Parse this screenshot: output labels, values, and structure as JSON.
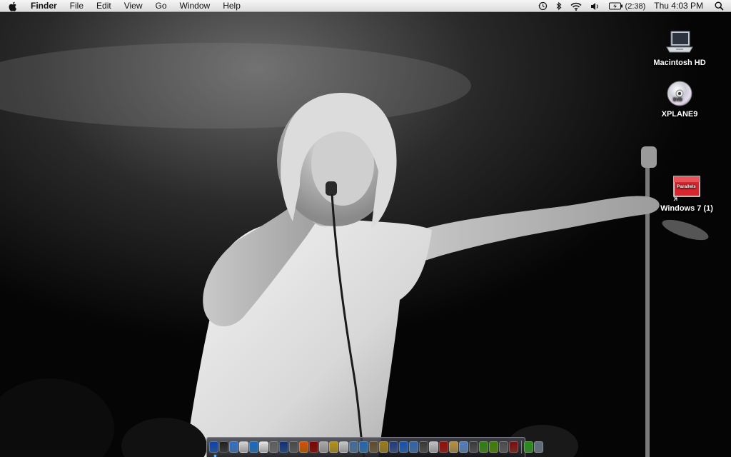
{
  "menubar": {
    "apple_icon": "apple-logo-icon",
    "app_name": "Finder",
    "menus": [
      "File",
      "Edit",
      "View",
      "Go",
      "Window",
      "Help"
    ],
    "status_icons": [
      "time-machine-icon",
      "bluetooth-icon",
      "wifi-icon",
      "volume-icon",
      "battery-icon",
      "spotlight-icon"
    ],
    "battery_time": "(2:38)",
    "clock": "Thu 4:03 PM"
  },
  "desktop": {
    "icons": [
      {
        "label": "Macintosh HD",
        "icon": "laptop-drive-icon"
      },
      {
        "label": "XPLANE9",
        "icon": "dvd-disc-icon"
      },
      {
        "label": "Windows 7 (1)",
        "icon": "parallels-vm-icon",
        "badge_text": "Parallels"
      }
    ]
  },
  "dock": {
    "apps": [
      {
        "icon": "finder-icon",
        "color": "#3d7fd6"
      },
      {
        "icon": "dashboard-icon",
        "color": "#5a5a5a"
      },
      {
        "icon": "safari-icon",
        "color": "#6aa8e6"
      },
      {
        "icon": "ichat-icon",
        "color": "#e8e8e8"
      },
      {
        "icon": "mail-icon",
        "color": "#4ba3e3"
      },
      {
        "icon": "textedit-icon",
        "color": "#f1f1f1"
      },
      {
        "icon": "system-preferences-icon",
        "color": "#9a9a9a"
      },
      {
        "icon": "network-icon",
        "color": "#3f6fb0"
      },
      {
        "icon": "dvd-player-icon",
        "color": "#888888"
      },
      {
        "icon": "vlc-icon",
        "color": "#f08a1c"
      },
      {
        "icon": "photo-booth-icon",
        "color": "#b3261e"
      },
      {
        "icon": "game-icon",
        "color": "#cfcfcf"
      },
      {
        "icon": "star-app-icon",
        "color": "#d9c04a"
      },
      {
        "icon": "calendar-icon",
        "color": "#e0e0e0"
      },
      {
        "icon": "iphoto-icon",
        "color": "#7fa6c8"
      },
      {
        "icon": "itunes-icon",
        "color": "#5aa0d8"
      },
      {
        "icon": "automator-icon",
        "color": "#9a8a6a"
      },
      {
        "icon": "gaming-icon",
        "color": "#c9b04a"
      },
      {
        "icon": "xcode-icon",
        "color": "#5d7bb3"
      },
      {
        "icon": "airplane-icon",
        "color": "#4c8fd8"
      },
      {
        "icon": "folder-icon",
        "color": "#6b9fd4"
      },
      {
        "icon": "microphone-icon",
        "color": "#777777"
      },
      {
        "icon": "mobile-icon",
        "color": "#dddddd"
      },
      {
        "icon": "red-app-icon",
        "color": "#c23a2c"
      },
      {
        "icon": "chess-icon",
        "color": "#d9c07a"
      },
      {
        "icon": "speech-icon",
        "color": "#8fb3e0"
      },
      {
        "icon": "utility-icon",
        "color": "#7a7a7a"
      },
      {
        "icon": "utorrent-icon",
        "color": "#6cb33e"
      },
      {
        "icon": "spotify-icon",
        "color": "#7bb32e"
      },
      {
        "icon": "trash-app-icon",
        "color": "#8a8a8a"
      },
      {
        "icon": "x-app-icon",
        "color": "#b0403a"
      }
    ],
    "stacks": [
      {
        "icon": "downloads-stack-icon",
        "color": "#5fbf4a"
      },
      {
        "icon": "trash-icon",
        "color": "#9aa6b4"
      }
    ]
  }
}
